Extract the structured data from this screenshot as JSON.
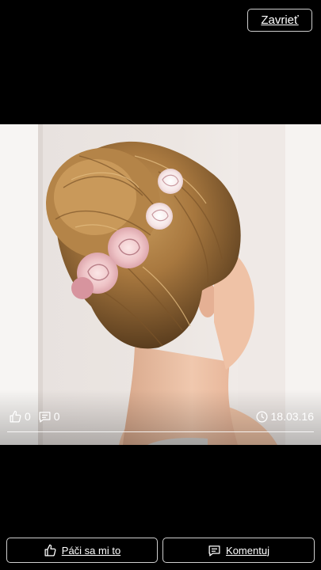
{
  "header": {
    "close_label": "Zavrieť"
  },
  "photo": {
    "subject": "updo-hairstyle-with-roses"
  },
  "meta": {
    "likes": "0",
    "comments": "0",
    "date": "18.03.16"
  },
  "actions": {
    "like_label": "Páči sa mi to",
    "comment_label": "Komentuj"
  },
  "icons": {
    "likes": "thumbs-up-icon",
    "comments": "comment-icon",
    "date": "clock-icon"
  },
  "colors": {
    "background": "#000000",
    "text": "#ffffff",
    "border": "#cfcfcf"
  }
}
